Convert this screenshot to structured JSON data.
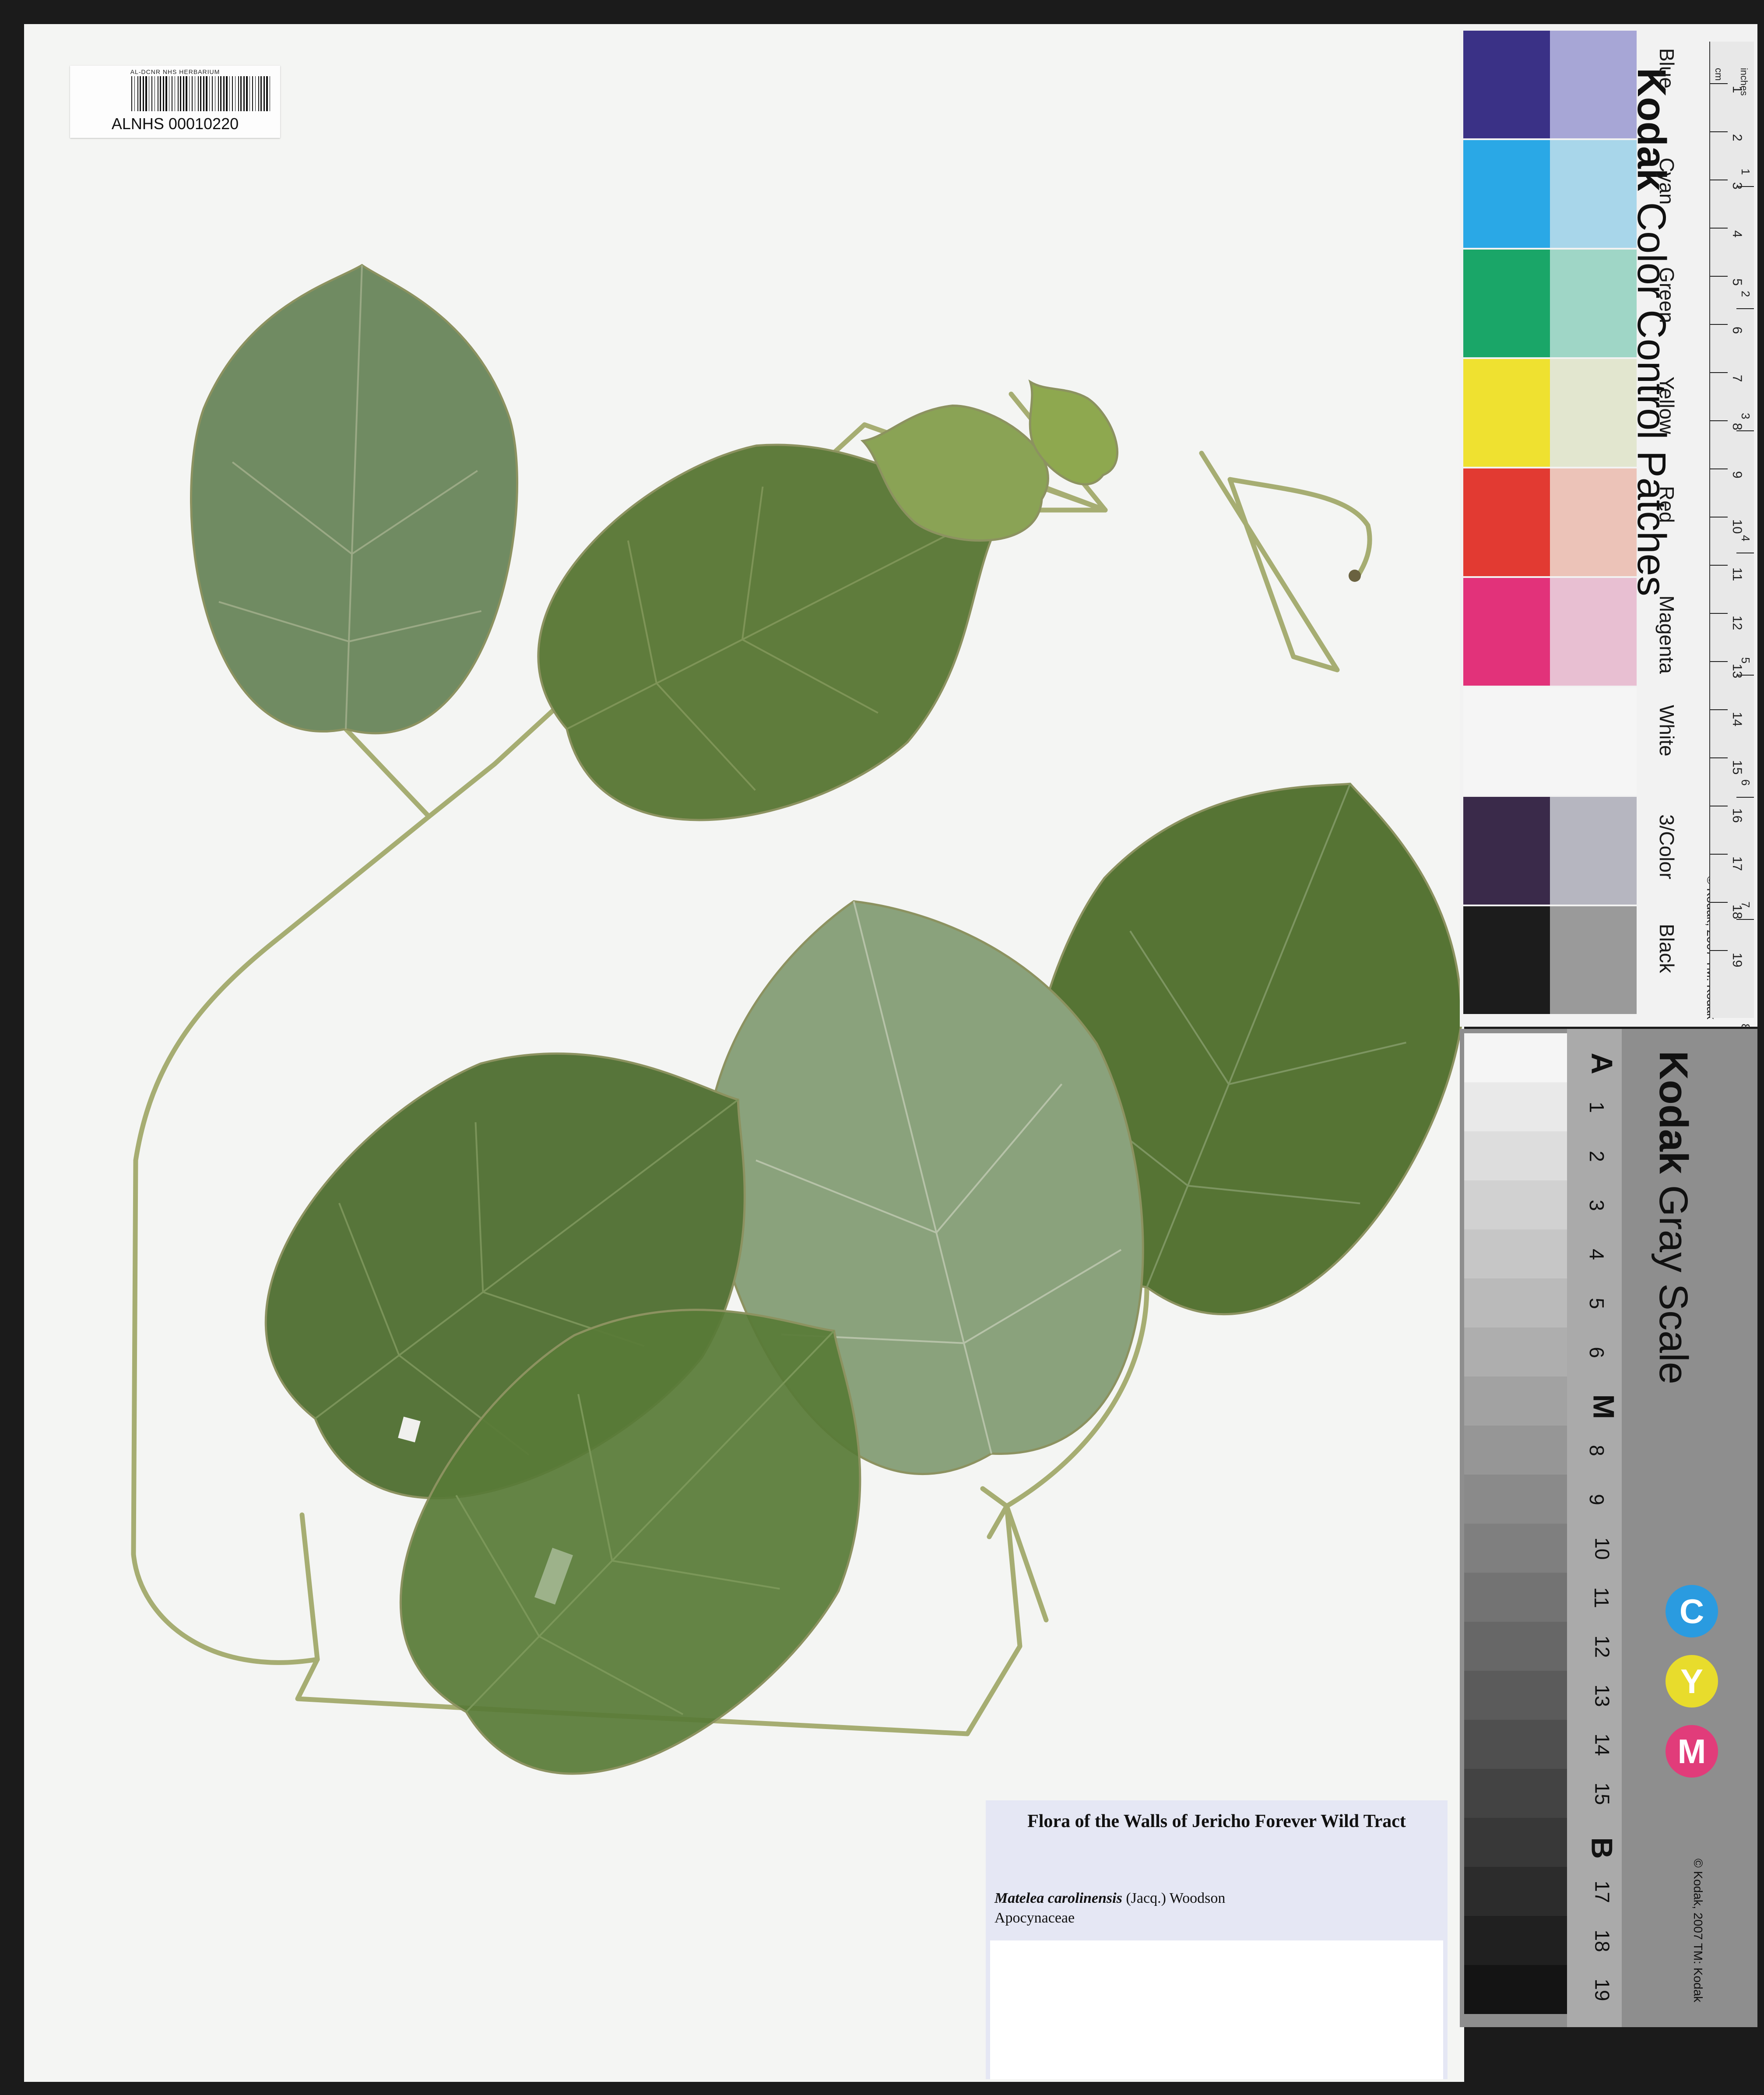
{
  "barcode": {
    "header": "AL-DCNR NHS HERBARIUM",
    "number": "ALNHS 00010220"
  },
  "label": {
    "title": "Flora of the Walls of Jericho Forever Wild Tract",
    "genus_species": "Matelea carolinensis",
    "author": " (Jacq.) Woodson",
    "family": "Apocynaceae"
  },
  "color_card": {
    "brand_bold": "Kodak",
    "brand_rest": " Color Control Patches",
    "copyright": "© Kodak, 2007 TM: Kodak",
    "unit_cm": "cm",
    "unit_in": "inches",
    "patches": [
      {
        "label": "Blue",
        "dark": "#3a3186",
        "light": "#a7a6d6"
      },
      {
        "label": "Cyan",
        "dark": "#2aa8e6",
        "light": "#a8d6ea"
      },
      {
        "label": "Green",
        "dark": "#1aa668",
        "light": "#9fd6c6"
      },
      {
        "label": "Yellow",
        "dark": "#efe130",
        "light": "#e2e6cf"
      },
      {
        "label": "Red",
        "dark": "#e23a32",
        "light": "#ecc3b8"
      },
      {
        "label": "Magenta",
        "dark": "#e2327a",
        "light": "#e8bfd2"
      },
      {
        "label": "White",
        "dark": "#f5f5f5",
        "light": "#f5f5f5"
      },
      {
        "label": "3/Color",
        "dark": "#3a2a4a",
        "light": "#b6b6c0"
      },
      {
        "label": "Black",
        "dark": "#1c1c1c",
        "light": "#9a9a9a"
      }
    ],
    "ruler_cm": [
      "1",
      "2",
      "3",
      "4",
      "5",
      "6",
      "7",
      "8",
      "9",
      "10",
      "11",
      "12",
      "13",
      "14",
      "15",
      "16",
      "17",
      "18",
      "19"
    ],
    "ruler_in": [
      "1",
      "2",
      "3",
      "4",
      "5",
      "6",
      "7",
      "8"
    ]
  },
  "gray_card": {
    "brand_bold": "Kodak",
    "brand_rest": " Gray Scale",
    "copyright": "© Kodak, 2007 TM: Kodak",
    "steps": [
      "A",
      "1",
      "2",
      "3",
      "4",
      "5",
      "6",
      "M",
      "8",
      "9",
      "10",
      "11",
      "12",
      "13",
      "14",
      "15",
      "B",
      "17",
      "18",
      "19"
    ],
    "dots": [
      {
        "letter": "C",
        "color": "#2a9be0"
      },
      {
        "letter": "Y",
        "color": "#e8dc2c"
      },
      {
        "letter": "M",
        "color": "#e13c7a"
      }
    ]
  }
}
